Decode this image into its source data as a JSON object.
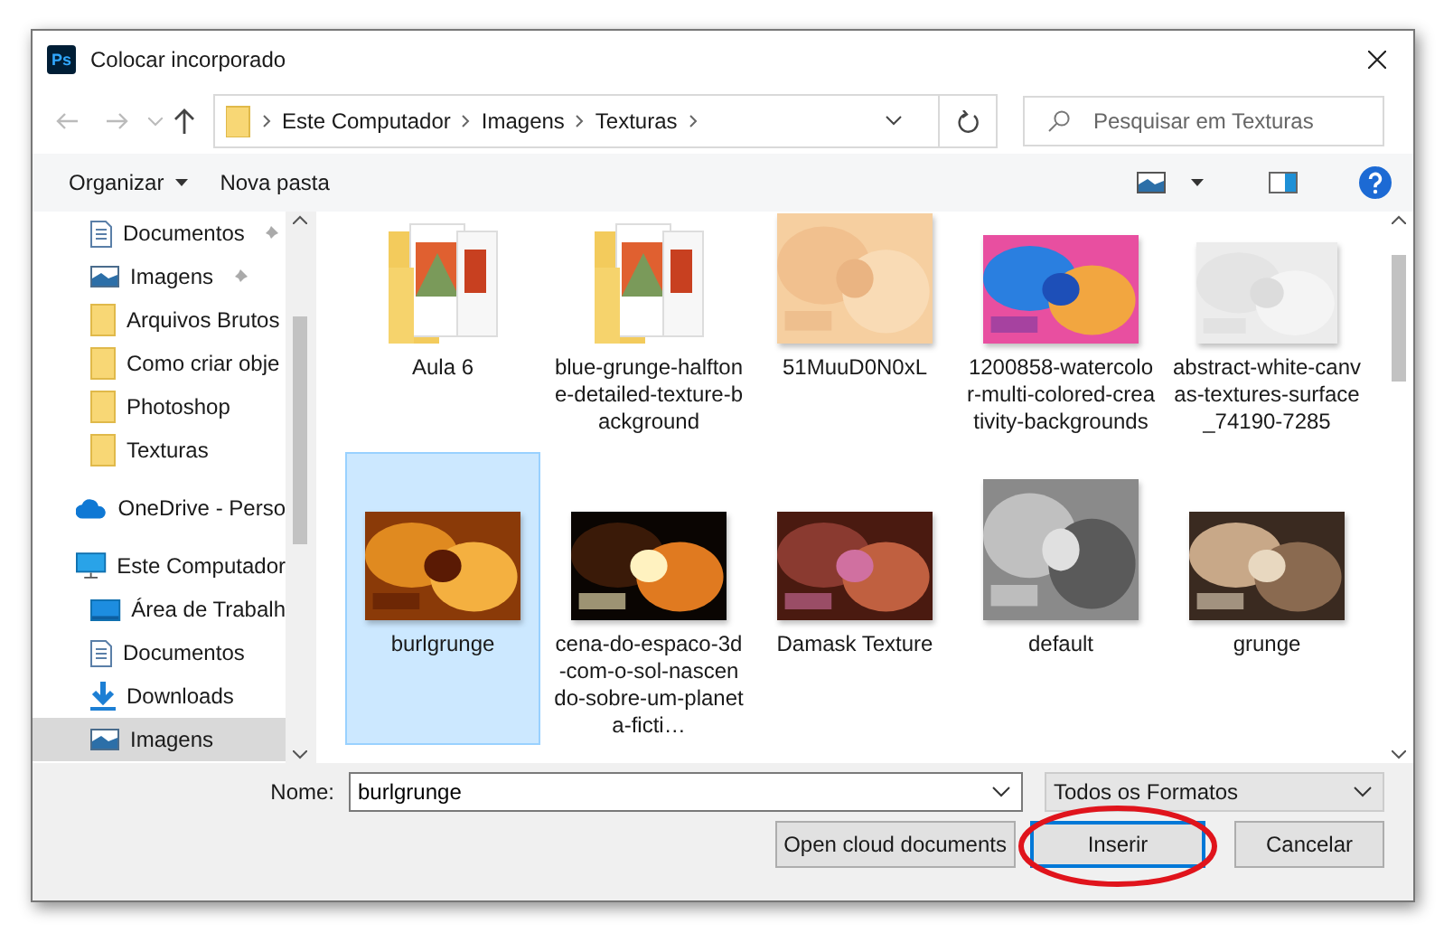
{
  "window": {
    "title": "Colocar incorporado",
    "app_badge": "Ps"
  },
  "navigation": {
    "back_disabled": true,
    "forward_disabled": true
  },
  "address_bar": {
    "path": [
      "Este Computador",
      "Imagens",
      "Texturas"
    ]
  },
  "search": {
    "placeholder": "Pesquisar em Texturas"
  },
  "toolbar": {
    "buttons": [
      {
        "label": "Organizar",
        "has_menu": true
      },
      {
        "label": "Nova pasta",
        "has_menu": false
      }
    ]
  },
  "sidebar": {
    "quick_access": [
      {
        "label": "Documentos",
        "kind": "documents",
        "pinned": true,
        "selected": false
      },
      {
        "label": "Imagens",
        "kind": "pictures",
        "pinned": true,
        "selected": false
      },
      {
        "label": "Arquivos Brutos",
        "kind": "folder",
        "pinned": false,
        "selected": false
      },
      {
        "label": "Como criar obje",
        "kind": "folder",
        "pinned": false,
        "selected": false
      },
      {
        "label": "Photoshop",
        "kind": "folder",
        "pinned": false,
        "selected": false
      },
      {
        "label": "Texturas",
        "kind": "folder",
        "pinned": false,
        "selected": false
      }
    ],
    "items": [
      {
        "label": "OneDrive - Perso",
        "kind": "cloud",
        "selected": false
      },
      {
        "label": "Este Computador",
        "kind": "computer",
        "selected": false,
        "children": [
          {
            "label": "Área de Trabalh",
            "kind": "desktop",
            "selected": false
          },
          {
            "label": "Documentos",
            "kind": "documents",
            "selected": false
          },
          {
            "label": "Downloads",
            "kind": "download",
            "selected": false
          },
          {
            "label": "Imagens",
            "kind": "pictures",
            "selected": true
          }
        ]
      }
    ]
  },
  "files": [
    {
      "name": "Aula 6",
      "kind": "folder",
      "selected": false
    },
    {
      "name": "blue-grunge-halftone-detailed-texture-background",
      "kind": "folder",
      "selected": false
    },
    {
      "name": "51MuuD0N0xL",
      "kind": "picture",
      "selected": false
    },
    {
      "name": "1200858-watercolor-multi-colored-creativity-backgrounds",
      "kind": "picture",
      "selected": false
    },
    {
      "name": "abstract-white-canvas-textures-surface_74190-7285",
      "kind": "picture",
      "selected": false
    },
    {
      "name": "burlgrunge",
      "kind": "picture",
      "selected": true
    },
    {
      "name": "cena-do-espaco-3d-com-o-sol-nascendo-sobre-um-planeta-ficti…",
      "kind": "picture",
      "selected": false
    },
    {
      "name": "Damask Texture",
      "kind": "picture",
      "selected": false
    },
    {
      "name": "default",
      "kind": "picture",
      "selected": false
    },
    {
      "name": "grunge",
      "kind": "picture",
      "selected": false
    }
  ],
  "file_name": {
    "label": "Nome:",
    "value": "burlgrunge"
  },
  "file_type": {
    "value": "Todos os Formatos"
  },
  "buttons": [
    {
      "label": "Open cloud documents",
      "kind": "plain",
      "circled": false
    },
    {
      "label": "Inserir",
      "kind": "default",
      "circled": true
    },
    {
      "label": "Cancelar",
      "kind": "plain",
      "circled": false
    }
  ]
}
